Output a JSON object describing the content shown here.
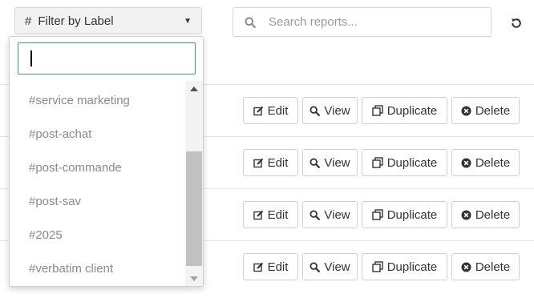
{
  "filter": {
    "hash": "#",
    "label": "Filter by Label"
  },
  "search": {
    "placeholder": "Search reports..."
  },
  "icons": {
    "search": "search-icon",
    "refresh": "refresh-icon",
    "edit": "edit-icon",
    "view": "view-icon",
    "duplicate": "duplicate-icon",
    "delete": "delete-icon",
    "caret": "caret-down-icon"
  },
  "dropdown": {
    "input_value": "",
    "items": [
      {
        "label": "#service marketing"
      },
      {
        "label": "#post-achat"
      },
      {
        "label": "#post-commande"
      },
      {
        "label": "#post-sav"
      },
      {
        "label": "#2025"
      },
      {
        "label": "#verbatim client"
      }
    ]
  },
  "actions": {
    "edit": "Edit",
    "view": "View",
    "duplicate": "Duplicate",
    "delete": "Delete"
  },
  "rows": [
    {
      "id": "row-1"
    },
    {
      "id": "row-2"
    },
    {
      "id": "row-3"
    },
    {
      "id": "row-4"
    }
  ],
  "colors": {
    "accent": "#3c8dbc",
    "border": "#cfcfcf",
    "item_text": "#8a8a8a"
  }
}
